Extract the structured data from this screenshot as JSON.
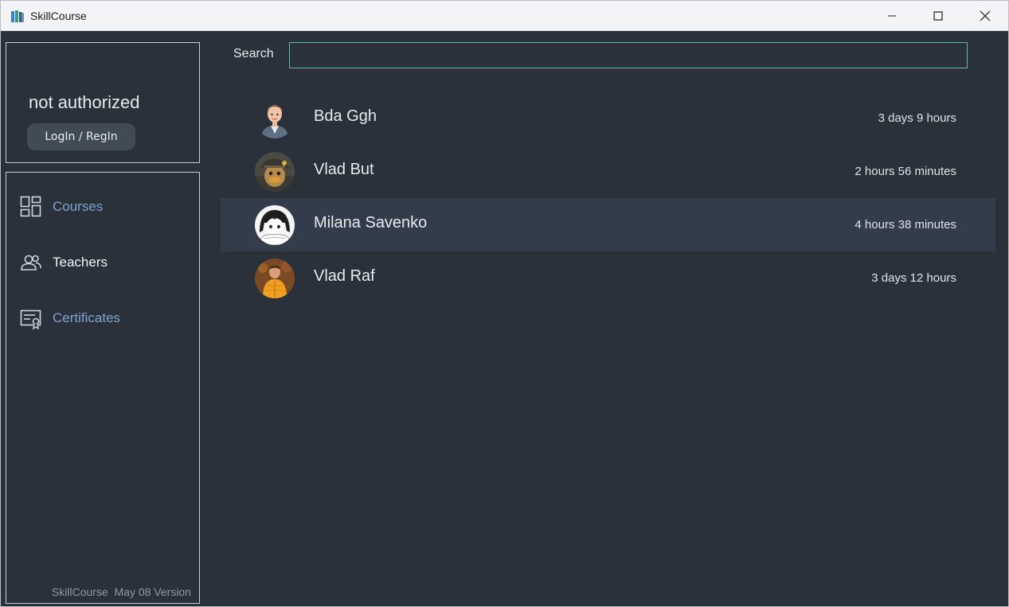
{
  "window": {
    "title": "SkillCourse",
    "app_icon": "books-icon",
    "controls": [
      "minimize-icon",
      "maximize-icon",
      "close-icon"
    ]
  },
  "auth": {
    "status": "not authorized",
    "login_label": "LogIn / RegIn"
  },
  "nav": {
    "items": [
      {
        "label": "Courses",
        "icon": "grid-icon",
        "color": "#7fa3d1"
      },
      {
        "label": "Teachers",
        "icon": "people-icon",
        "color": "#f1f3f5"
      },
      {
        "label": "Certificates",
        "icon": "certificate-icon",
        "color": "#7fa3d1"
      }
    ]
  },
  "footer": {
    "text": "SkillCourse  May 08 Version"
  },
  "search": {
    "label": "Search",
    "value": "",
    "placeholder": ""
  },
  "teachers": [
    {
      "name": "Bda Ggh",
      "duration": "3 days 9 hours",
      "avatar": "cartoon-man-avatar"
    },
    {
      "name": "Vlad But",
      "duration": "2 hours 56 minutes",
      "avatar": "duck-hat-avatar"
    },
    {
      "name": "Milana Savenko",
      "duration": "4 hours 38 minutes",
      "avatar": "anime-girl-avatar",
      "selected": true
    },
    {
      "name": "Vlad Raf",
      "duration": "3 days 12 hours",
      "avatar": "yellow-jacket-avatar"
    }
  ],
  "colors": {
    "background": "#2a313b",
    "selected_row": "#333c4a",
    "accent_link": "#7fa3d1",
    "search_border": "#63b8a0",
    "button": "#414b56"
  }
}
